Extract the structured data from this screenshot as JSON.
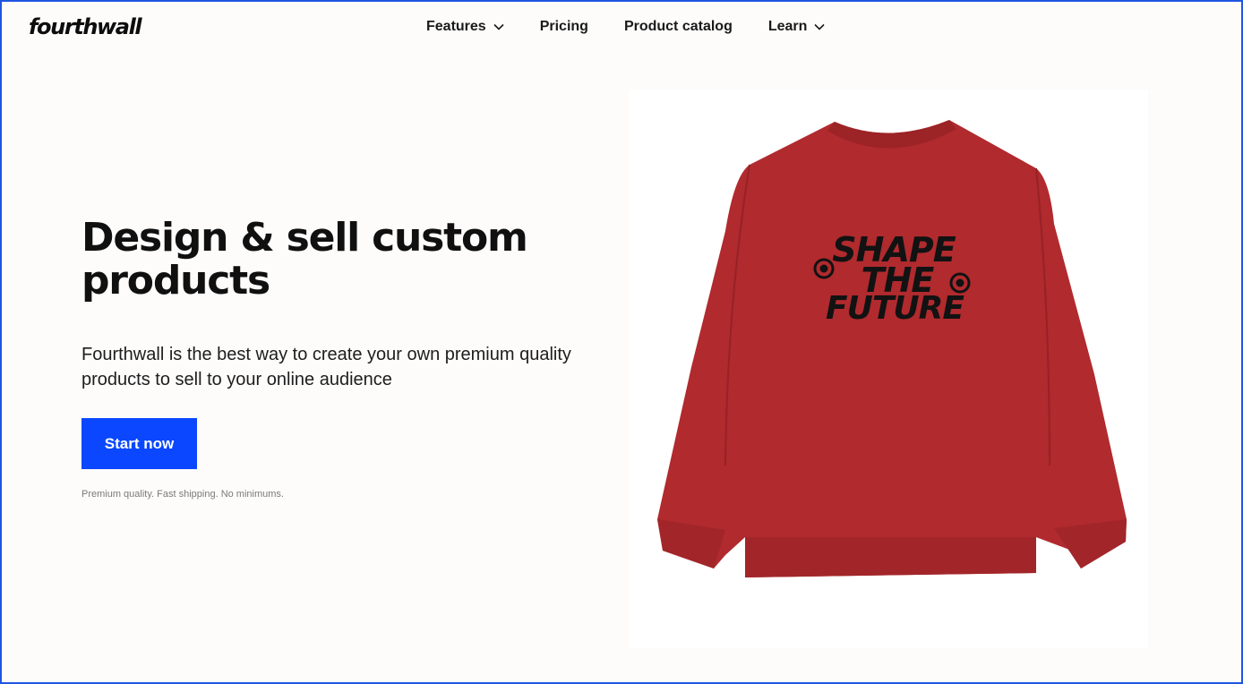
{
  "header": {
    "logo": "fourthwall",
    "nav": [
      {
        "label": "Features",
        "has_dropdown": true
      },
      {
        "label": "Pricing",
        "has_dropdown": false
      },
      {
        "label": "Product catalog",
        "has_dropdown": false
      },
      {
        "label": "Learn",
        "has_dropdown": true
      }
    ]
  },
  "hero": {
    "headline": "Design & sell custom products",
    "subtext": "Fourthwall is the best way to create your own premium quality products to sell to your online audience",
    "cta_label": "Start now",
    "fineprint": "Premium quality. Fast shipping. No minimums."
  },
  "product_image": {
    "print_lines": [
      "SHAPE",
      "THE",
      "FUTURE"
    ],
    "sweatshirt_color": "#b02a2e",
    "print_color": "#121212"
  },
  "colors": {
    "accent": "#0a47ff",
    "frame_border": "#1f55e0",
    "background": "#fdfcfb"
  }
}
